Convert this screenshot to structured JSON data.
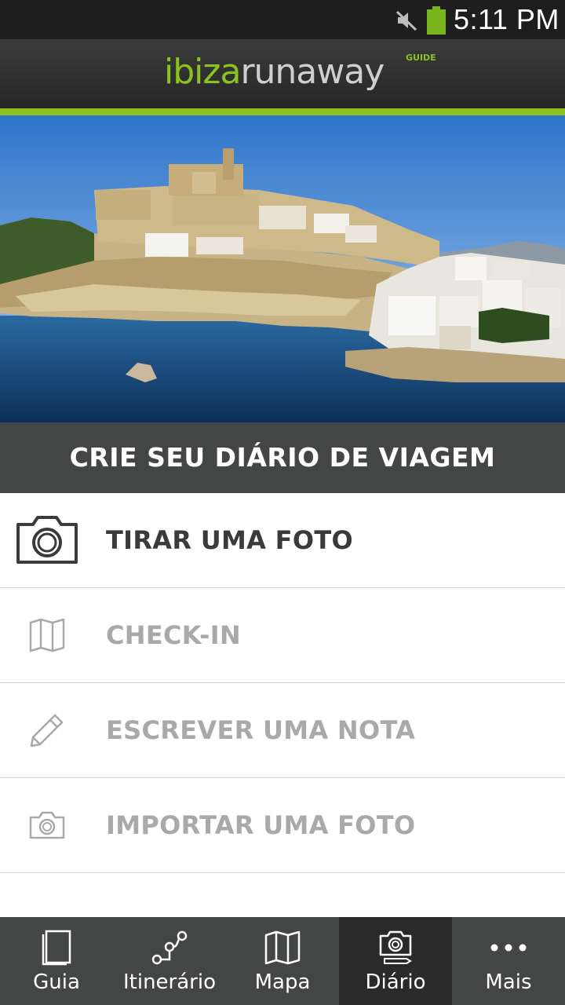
{
  "status_bar": {
    "time": "5:11 PM",
    "icons": [
      "mute-icon",
      "battery-icon"
    ],
    "battery_color": "#7ab51d"
  },
  "header": {
    "logo_ibiza": "ibiza",
    "logo_runaway": "runaway",
    "logo_guide": "GUIDE",
    "accent_color": "#8cc21f"
  },
  "hero": {
    "icon": "ibiza-town-photo"
  },
  "section": {
    "title": "CRIE SEU DIÁRIO DE VIAGEM"
  },
  "menu": [
    {
      "label": "TIRAR UMA FOTO",
      "icon": "camera-icon",
      "state": "active"
    },
    {
      "label": "CHECK-IN",
      "icon": "map-icon",
      "state": "disabled"
    },
    {
      "label": "ESCREVER UMA NOTA",
      "icon": "pencil-icon",
      "state": "disabled"
    },
    {
      "label": "IMPORTAR UMA FOTO",
      "icon": "camera-small-icon",
      "state": "disabled"
    }
  ],
  "bottom_nav": [
    {
      "label": "Guia",
      "icon": "book-icon"
    },
    {
      "label": "Itinerário",
      "icon": "route-icon"
    },
    {
      "label": "Mapa",
      "icon": "map-icon"
    },
    {
      "label": "Diário",
      "icon": "diary-camera-icon",
      "selected": true
    },
    {
      "label": "Mais",
      "icon": "more-dots-icon"
    }
  ]
}
